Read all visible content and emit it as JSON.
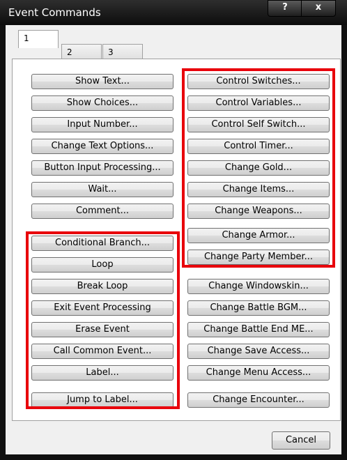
{
  "window": {
    "title": "Event Commands",
    "help_label": "?",
    "close_label": "x"
  },
  "tabs": [
    {
      "label": "1",
      "active": true
    },
    {
      "label": "2",
      "active": false
    },
    {
      "label": "3",
      "active": false
    }
  ],
  "left_column": [
    "Show Text...",
    "Show Choices...",
    "Input Number...",
    "Change Text Options...",
    "Button Input Processing...",
    "Wait...",
    "Comment...",
    "Conditional Branch...",
    "Loop",
    "Break Loop",
    "Exit Event Processing",
    "Erase Event",
    "Call Common Event...",
    "Label...",
    "Jump to Label..."
  ],
  "right_column": [
    "Control Switches...",
    "Control Variables...",
    "Control Self Switch...",
    "Control Timer...",
    "Change Gold...",
    "Change Items...",
    "Change Weapons...",
    "Change Armor...",
    "Change Party Member...",
    "Change Windowskin...",
    "Change Battle BGM...",
    "Change Battle End ME...",
    "Change Save Access...",
    "Change Menu Access...",
    "Change Encounter..."
  ],
  "footer": {
    "cancel_label": "Cancel"
  },
  "colors": {
    "highlight": "#e8000b",
    "titlebar": "#1c1c1c",
    "panel": "#f0f0f0"
  }
}
